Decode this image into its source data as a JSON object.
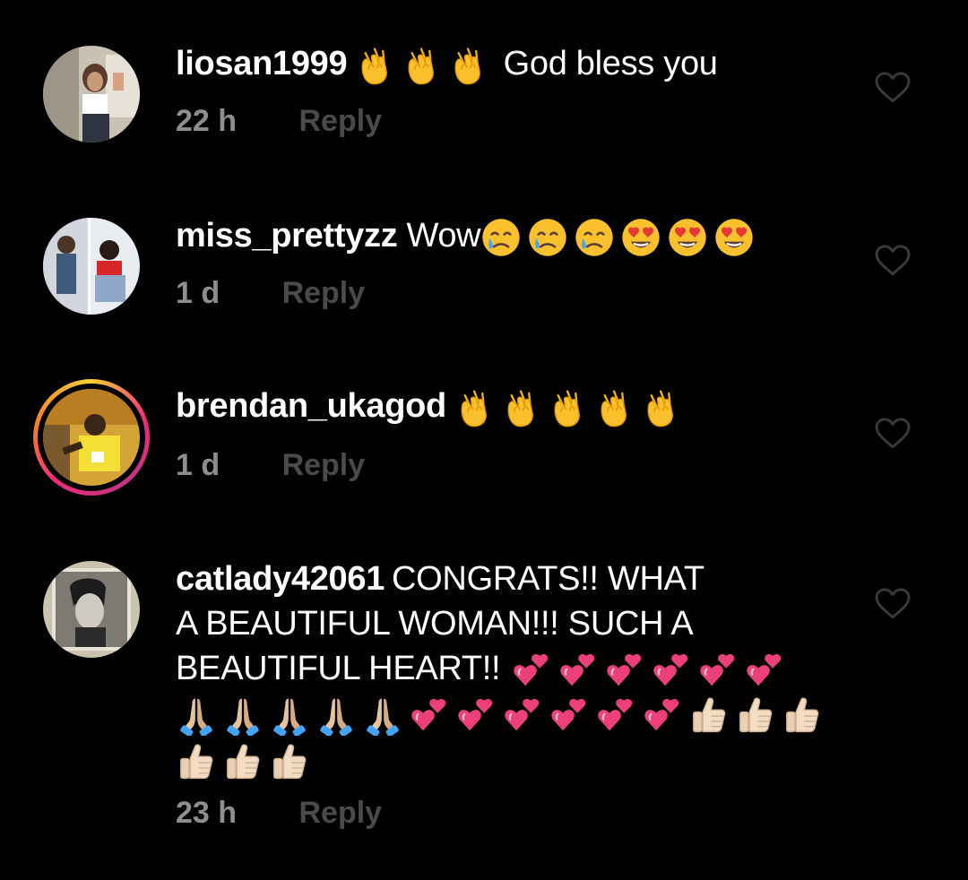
{
  "comments": [
    {
      "username": "liosan1999",
      "text": "God bless you",
      "time": "22 h",
      "reply": "Reply",
      "emoji_before_text": [
        "clapping-hands",
        "clapping-hands",
        "clapping-hands"
      ],
      "has_story_ring": false
    },
    {
      "username": "miss_prettyzz",
      "text": "Wow",
      "time": "1 d",
      "reply": "Reply",
      "emoji_after_text": [
        "crying-face",
        "crying-face",
        "crying-face",
        "heart-eyes-face",
        "heart-eyes-face",
        "heart-eyes-face"
      ],
      "has_story_ring": false
    },
    {
      "username": "brendan_ukagod",
      "text": "",
      "time": "1 d",
      "reply": "Reply",
      "emoji_after_text": [
        "clapping-hands",
        "clapping-hands",
        "clapping-hands",
        "clapping-hands",
        "clapping-hands"
      ],
      "has_story_ring": true
    },
    {
      "username": "catlady42061",
      "text_line1": "CONGRATS!! WHAT",
      "text_line2": "A BEAUTIFUL WOMAN!!! SUCH A",
      "text_line3": "BEAUTIFUL HEART!!",
      "emoji_line3": [
        "two-hearts",
        "two-hearts",
        "two-hearts",
        "two-hearts",
        "two-hearts",
        "two-hearts"
      ],
      "emoji_line4": [
        "folded-hands",
        "folded-hands",
        "folded-hands",
        "folded-hands",
        "folded-hands",
        "two-hearts",
        "two-hearts",
        "two-hearts",
        "two-hearts",
        "two-hearts",
        "two-hearts",
        "thumbs-up",
        "thumbs-up",
        "thumbs-up"
      ],
      "emoji_line5": [
        "thumbs-up",
        "thumbs-up",
        "thumbs-up"
      ],
      "time": "23 h",
      "reply": "Reply",
      "has_story_ring": false
    }
  ],
  "colors": {
    "background": "#000000",
    "text": "#ffffff",
    "time": "#8e8e8e",
    "reply": "#4a4a4a",
    "heart_outline": "#3a3a3a",
    "story_ring": [
      "#f9ce34",
      "#ee2a7b",
      "#c13584"
    ]
  },
  "icons": {
    "like": "heart-outline-icon"
  }
}
